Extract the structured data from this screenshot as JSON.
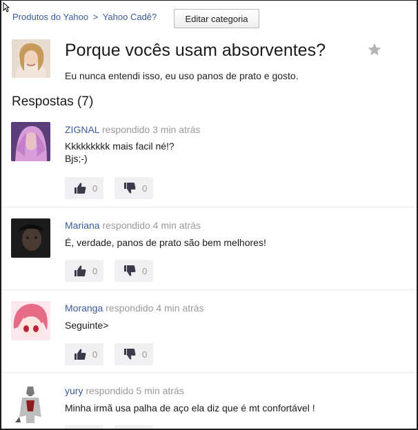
{
  "breadcrumb": {
    "items": [
      "Produtos do Yahoo",
      "Yahoo Cadê?"
    ],
    "separator": ">"
  },
  "edit_category_label": "Editar categoria",
  "question": {
    "title": "Porque vocês usam absorventes?",
    "body": "Eu nunca entendi isso, eu uso panos de prato e gosto.",
    "favorite_icon": "star-icon"
  },
  "answers_heading": "Respostas (7)",
  "answers": [
    {
      "user": "ZIGNAL",
      "answered": "respondido 3 min atrás",
      "text_lines": [
        "Kkkkkkkkk mais facil né!?",
        "Bjs;-)"
      ],
      "thumbs_up": "0",
      "thumbs_down": "0"
    },
    {
      "user": "Mariana",
      "answered": "respondido 4 min atrás",
      "text_lines": [
        "É, verdade, panos de prato são bem melhores!"
      ],
      "thumbs_up": "0",
      "thumbs_down": "0"
    },
    {
      "user": "Moranga",
      "answered": "respondido 4 min atrás",
      "text_lines": [
        "Seguinte>"
      ],
      "thumbs_up": "0",
      "thumbs_down": "0"
    },
    {
      "user": "yury",
      "answered": "respondido 5 min atrás",
      "text_lines": [
        "Minha irmã usa palha de aço ela diz que é mt confortável !"
      ],
      "thumbs_up": "",
      "thumbs_down": ""
    }
  ],
  "colors": {
    "link": "#3b5a9a",
    "muted": "#999999",
    "vote_bg": "#f0f0f2"
  }
}
